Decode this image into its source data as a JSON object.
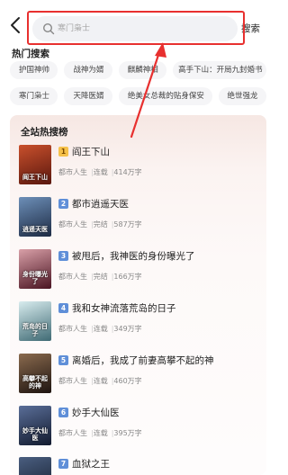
{
  "header": {
    "search_placeholder": "寒门枭士",
    "search_button": "搜索"
  },
  "hot_search": {
    "title": "热门搜索",
    "rows": [
      [
        "护国神帅",
        "战神为婿",
        "麒麟神相",
        "高手下山：开局九封婚书"
      ],
      [
        "寒门枭士",
        "天降医婿",
        "绝美女总裁的贴身保安",
        "绝世强龙"
      ]
    ]
  },
  "ranking": {
    "title": "全站热搜榜",
    "books": [
      {
        "rank": "1",
        "title": "阎王下山",
        "genre": "都市人生",
        "status": "连载",
        "words": "414万字",
        "cover_text": "阎王下山",
        "cover_color": "#8a2a1c"
      },
      {
        "rank": "2",
        "title": "都市逍遥天医",
        "genre": "都市人生",
        "status": "完结",
        "words": "587万字",
        "cover_text": "逍遥天医",
        "cover_color": "#2a3e5e"
      },
      {
        "rank": "3",
        "title": "被甩后，我神医的身份曝光了",
        "genre": "都市人生",
        "status": "完结",
        "words": "166万字",
        "cover_text": "身份曝光了",
        "cover_color": "#5a1e2e"
      },
      {
        "rank": "4",
        "title": "我和女神流落荒岛的日子",
        "genre": "都市人生",
        "status": "连载",
        "words": "349万字",
        "cover_text": "荒岛的日子",
        "cover_color": "#4f7a86"
      },
      {
        "rank": "5",
        "title": "离婚后，我成了前妻高攀不起的神",
        "genre": "都市人生",
        "status": "连载",
        "words": "460万字",
        "cover_text": "高攀不起的神",
        "cover_color": "#3b2a24"
      },
      {
        "rank": "6",
        "title": "妙手大仙医",
        "genre": "都市人生",
        "status": "连载",
        "words": "395万字",
        "cover_text": "妙手大仙医",
        "cover_color": "#1f2a44"
      },
      {
        "rank": "7",
        "title": "血狱之王",
        "genre": "",
        "status": "",
        "words": "",
        "cover_text": "",
        "cover_color": "#22324a"
      }
    ]
  },
  "colors": {
    "annotation_red": "#e8302f",
    "rank_gold": "#f5c14a",
    "rank_blue": "#5f8fd8"
  },
  "icons": [
    "back-arrow-icon",
    "search-icon",
    "rank-badge-icon"
  ]
}
